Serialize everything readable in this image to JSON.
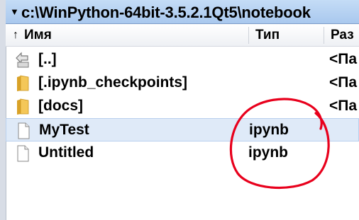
{
  "path": {
    "text": "c:\\WinPython-64bit-3.5.2.1Qt5\\notebook"
  },
  "columns": {
    "name": "Имя",
    "type": "Тип",
    "size": "Раз"
  },
  "rows": [
    {
      "name": "[..]",
      "type": "",
      "size": "<Па",
      "icon": "up-folder-icon"
    },
    {
      "name": "[.ipynb_checkpoints]",
      "type": "",
      "size": "<Па",
      "icon": "folder-icon"
    },
    {
      "name": "[docs]",
      "type": "",
      "size": "<Па",
      "icon": "folder-icon"
    },
    {
      "name": "MyTest",
      "type": "ipynb",
      "size": "",
      "icon": "file-icon"
    },
    {
      "name": "Untitled",
      "type": "ipynb",
      "size": "",
      "icon": "file-icon"
    }
  ],
  "colors": {
    "pathbar": "#b7d1f2",
    "selection": "#dfeaf8",
    "annotation": "#e8001c",
    "folder": "#f2c14e"
  }
}
